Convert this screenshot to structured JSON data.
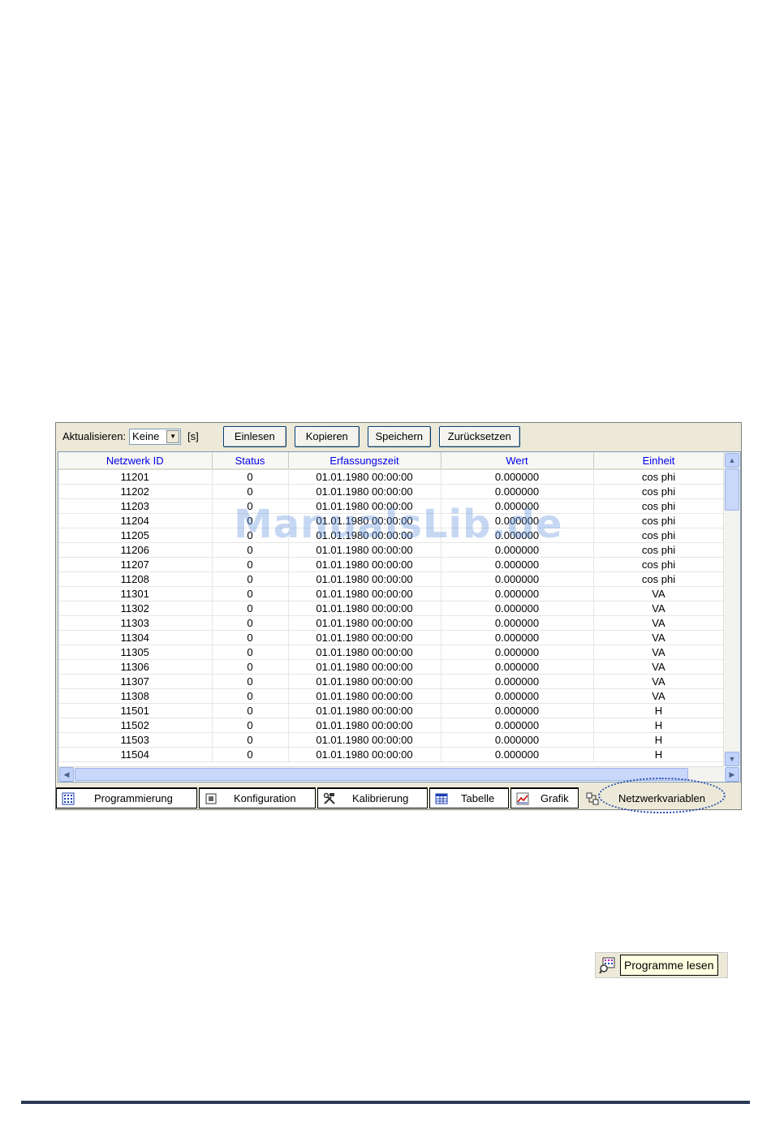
{
  "toolbar": {
    "refresh_label": "Aktualisieren:",
    "refresh_value": "Keine",
    "unit": "[s]",
    "buttons": [
      "Einlesen",
      "Kopieren",
      "Speichern",
      "Zurücksetzen"
    ]
  },
  "table": {
    "headers": [
      "Netzwerk ID",
      "Status",
      "Erfassungszeit",
      "Wert",
      "Einheit"
    ],
    "rows": [
      [
        "11201",
        "0",
        "01.01.1980 00:00:00",
        "0.000000",
        "cos phi"
      ],
      [
        "11202",
        "0",
        "01.01.1980 00:00:00",
        "0.000000",
        "cos phi"
      ],
      [
        "11203",
        "0",
        "01.01.1980 00:00:00",
        "0.000000",
        "cos phi"
      ],
      [
        "11204",
        "0",
        "01.01.1980 00:00:00",
        "0.000000",
        "cos phi"
      ],
      [
        "11205",
        "0",
        "01.01.1980 00:00:00",
        "0.000000",
        "cos phi"
      ],
      [
        "11206",
        "0",
        "01.01.1980 00:00:00",
        "0.000000",
        "cos phi"
      ],
      [
        "11207",
        "0",
        "01.01.1980 00:00:00",
        "0.000000",
        "cos phi"
      ],
      [
        "11208",
        "0",
        "01.01.1980 00:00:00",
        "0.000000",
        "cos phi"
      ],
      [
        "11301",
        "0",
        "01.01.1980 00:00:00",
        "0.000000",
        "VA"
      ],
      [
        "11302",
        "0",
        "01.01.1980 00:00:00",
        "0.000000",
        "VA"
      ],
      [
        "11303",
        "0",
        "01.01.1980 00:00:00",
        "0.000000",
        "VA"
      ],
      [
        "11304",
        "0",
        "01.01.1980 00:00:00",
        "0.000000",
        "VA"
      ],
      [
        "11305",
        "0",
        "01.01.1980 00:00:00",
        "0.000000",
        "VA"
      ],
      [
        "11306",
        "0",
        "01.01.1980 00:00:00",
        "0.000000",
        "VA"
      ],
      [
        "11307",
        "0",
        "01.01.1980 00:00:00",
        "0.000000",
        "VA"
      ],
      [
        "11308",
        "0",
        "01.01.1980 00:00:00",
        "0.000000",
        "VA"
      ],
      [
        "11501",
        "0",
        "01.01.1980 00:00:00",
        "0.000000",
        "H"
      ],
      [
        "11502",
        "0",
        "01.01.1980 00:00:00",
        "0.000000",
        "H"
      ],
      [
        "11503",
        "0",
        "01.01.1980 00:00:00",
        "0.000000",
        "H"
      ],
      [
        "11504",
        "0",
        "01.01.1980 00:00:00",
        "0.000000",
        "H"
      ]
    ]
  },
  "tabs": [
    {
      "label": "Programmierung",
      "icon": "grid-icon"
    },
    {
      "label": "Konfiguration",
      "icon": "chip-icon"
    },
    {
      "label": "Kalibrierung",
      "icon": "tools-icon"
    },
    {
      "label": "Tabelle",
      "icon": "table-icon"
    },
    {
      "label": "Grafik",
      "icon": "chart-icon"
    },
    {
      "label": "Netzwerkvariablen",
      "icon": "network-icon"
    }
  ],
  "active_tab": "Netzwerkvariablen",
  "watermark": "ManualsLib.de",
  "program_button": {
    "label": "Programme lesen",
    "icon": "read-programs-icon"
  },
  "colors": {
    "header_text": "#0000ee",
    "highlight": "#2a4db0",
    "footer_rule": "#2b3a55"
  }
}
